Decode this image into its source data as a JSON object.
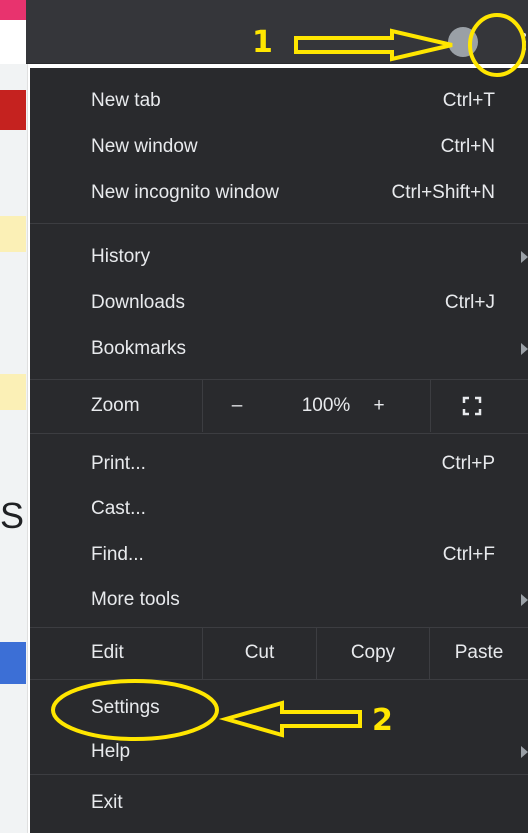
{
  "colors": {
    "menu_bg": "#292a2d",
    "toolbar_bg": "#35363a",
    "menu_text": "#e8eaed",
    "separator": "#3c3d41",
    "annotation": "#ffe600"
  },
  "toolbar": {
    "avatar_icon": "profile-avatar-icon",
    "menu_icon": "three-dot-menu-icon"
  },
  "menu": {
    "group1": [
      {
        "label": "New tab",
        "shortcut": "Ctrl+T"
      },
      {
        "label": "New window",
        "shortcut": "Ctrl+N"
      },
      {
        "label": "New incognito window",
        "shortcut": "Ctrl+Shift+N"
      }
    ],
    "group2": [
      {
        "label": "History",
        "shortcut": ""
      },
      {
        "label": "Downloads",
        "shortcut": "Ctrl+J"
      },
      {
        "label": "Bookmarks",
        "shortcut": ""
      }
    ],
    "zoom": {
      "label": "Zoom",
      "minus": "–",
      "value": "100%",
      "plus": "+",
      "fullscreen_icon": "fullscreen-icon"
    },
    "group3": [
      {
        "label": "Print...",
        "shortcut": "Ctrl+P"
      },
      {
        "label": "Cast...",
        "shortcut": ""
      },
      {
        "label": "Find...",
        "shortcut": "Ctrl+F"
      },
      {
        "label": "More tools",
        "shortcut": ""
      }
    ],
    "edit": {
      "label": "Edit",
      "cut": "Cut",
      "copy": "Copy",
      "paste": "Paste"
    },
    "group4": [
      {
        "label": "Settings"
      },
      {
        "label": "Help"
      }
    ],
    "exit": "Exit"
  },
  "annotations": {
    "step1": "1",
    "step2": "2"
  },
  "background": {
    "stray_glyph": "S"
  }
}
